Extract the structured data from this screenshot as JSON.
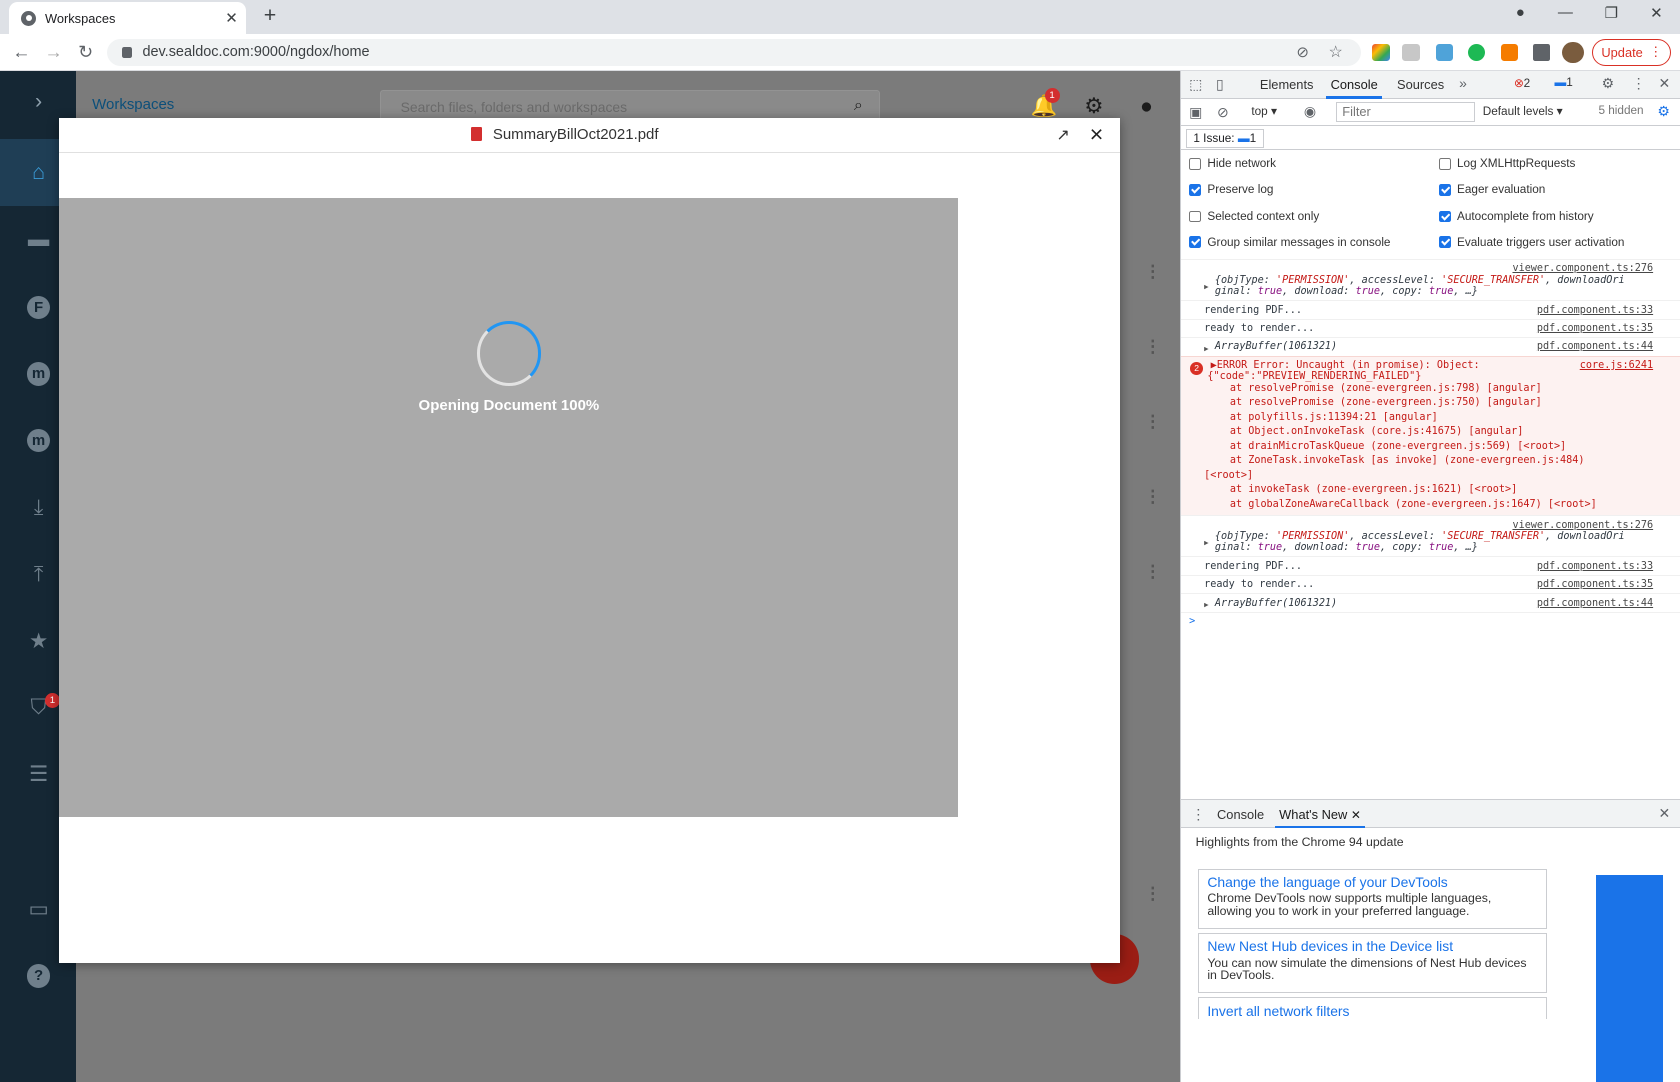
{
  "browser": {
    "tab_title": "Workspaces",
    "url": "dev.sealdoc.com:9000/ngdox/home",
    "update_label": "Update"
  },
  "app": {
    "brand_alt": "Workspaces",
    "search_placeholder": "Search files, folders and workspaces",
    "notification_count": "1",
    "shield_badge": "1",
    "sidebar_letters": {
      "f": "F",
      "m1": "m",
      "m2": "m"
    }
  },
  "modal": {
    "filename": "SummaryBillOct2021.pdf",
    "loading_text": "Opening Document 100%"
  },
  "devtools": {
    "tabs": [
      "Elements",
      "Console",
      "Sources"
    ],
    "errors_count": "2",
    "messages_count": "1",
    "context": "top",
    "filter_placeholder": "Filter",
    "levels": "Default levels",
    "hidden": "5 hidden",
    "issues_label": "1 Issue:",
    "issues_count": "1",
    "settings": {
      "hide_network": "Hide network",
      "preserve_log": "Preserve log",
      "selected_context": "Selected context only",
      "group_similar": "Group similar messages in console",
      "log_xhr": "Log XMLHttpRequests",
      "eager_eval": "Eager evaluation",
      "autocomplete": "Autocomplete from history",
      "eval_triggers": "Evaluate triggers user activation"
    },
    "console": {
      "viewer_src": "viewer.component.ts:276",
      "perm_obj_1": "{objType: ",
      "perm_objtype": "'PERMISSION'",
      "perm_access_key": ", accessLevel: ",
      "perm_access": "'SECURE_TRANSFER'",
      "perm_rest1": ", downloadOri",
      "perm_line2a": "ginal: ",
      "perm_true": "true",
      "perm_dl": ", download: ",
      "perm_copy": ", copy: ",
      "perm_end": ", …}",
      "rendering": "rendering PDF...",
      "rendering_src": "pdf.component.ts:33",
      "ready": "ready to render...",
      "ready_src": "pdf.component.ts:35",
      "buffer": "ArrayBuffer(1061321)",
      "buffer_src": "pdf.component.ts:44",
      "error_count": "2",
      "error_head": "ERROR Error: Uncaught (in promise): Object:",
      "error_src": "core.js:6241",
      "error_code": "{\"code\":\"PREVIEW_RENDERING_FAILED\"}",
      "stack": [
        "at resolvePromise (zone-evergreen.js:798) [angular]",
        "at resolvePromise (zone-evergreen.js:750) [angular]",
        "at polyfills.js:11394:21 [angular]",
        "at Object.onInvokeTask (core.js:41675) [angular]",
        "at drainMicroTaskQueue (zone-evergreen.js:569) [<root>]",
        "at ZoneTask.invokeTask [as invoke] (zone-evergreen.js:484)",
        "[<root>]",
        "at invokeTask (zone-evergreen.js:1621) [<root>]",
        "at globalZoneAwareCallback (zone-evergreen.js:1647) [<root>]"
      ],
      "prompt": ">"
    },
    "drawer": {
      "tab_console": "Console",
      "tab_whatsnew": "What's New",
      "highlights": "Highlights from the Chrome 94 update",
      "cards": [
        {
          "title": "Change the language of your DevTools",
          "desc": "Chrome DevTools now supports multiple languages, allowing you to work in your preferred language."
        },
        {
          "title": "New Nest Hub devices in the Device list",
          "desc": "You can now simulate the dimensions of Nest Hub devices in DevTools."
        },
        {
          "title": "Invert all network filters",
          "desc": ""
        }
      ]
    }
  }
}
